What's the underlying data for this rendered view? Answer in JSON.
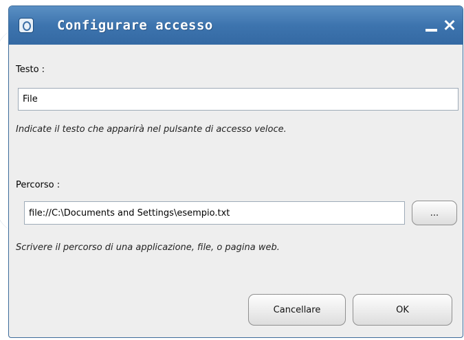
{
  "window": {
    "title": "Configurare accesso"
  },
  "form": {
    "text_label": "Testo :",
    "text_value": "File",
    "text_hint": "Indicate il testo che apparirà nel pulsante di accesso veloce.",
    "path_label": "Percorso :",
    "path_value": "file://C:\\Documents and Settings\\esempio.txt",
    "browse_label": "...",
    "path_hint": "Scrivere il percorso di una applicazione, file, o pagina web."
  },
  "buttons": {
    "cancel": "Cancellare",
    "ok": "OK"
  },
  "icons": {
    "app": "app-icon",
    "minimize": "minimize-icon",
    "close": "close-icon"
  },
  "colors": {
    "titlebar": "#3d74ae",
    "title_text": "#ffffff",
    "dialog_bg": "#eeeeee"
  }
}
